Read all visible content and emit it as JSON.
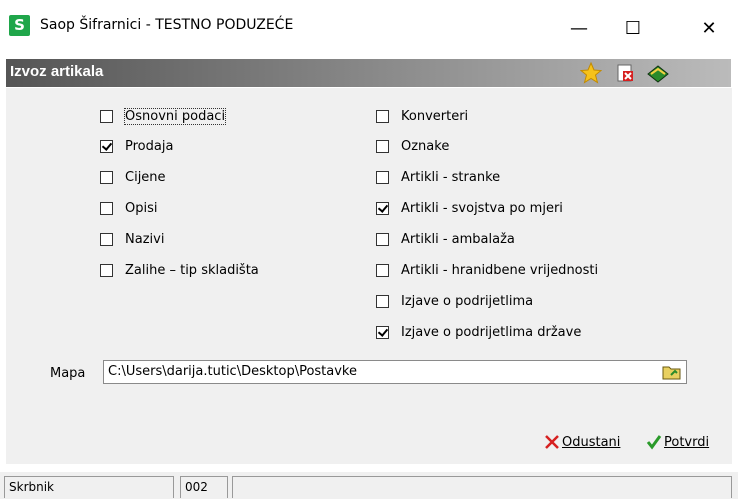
{
  "window": {
    "app_icon_letter": "S",
    "title": "Saop Šifrarnici - TESTNO PODUZEĆE",
    "minimize": "—",
    "maximize": "☐",
    "close": "✕"
  },
  "banner": {
    "title": "Izvoz artikala",
    "icons": [
      "star-icon",
      "delete-icon",
      "book-icon"
    ]
  },
  "left_checkboxes": [
    {
      "label": "Osnovni podaci",
      "checked": false
    },
    {
      "label": "Prodaja",
      "checked": true
    },
    {
      "label": "Cijene",
      "checked": false
    },
    {
      "label": "Opisi",
      "checked": false
    },
    {
      "label": "Nazivi",
      "checked": false
    },
    {
      "label": "Zalihe – tip skladišta",
      "checked": false
    }
  ],
  "right_checkboxes": [
    {
      "label": "Konverteri",
      "checked": false
    },
    {
      "label": "Oznake",
      "checked": false
    },
    {
      "label": "Artikli - stranke",
      "checked": false
    },
    {
      "label": "Artikli - svojstva po mjeri",
      "checked": true
    },
    {
      "label": "Artikli - ambalaža",
      "checked": false
    },
    {
      "label": "Artikli - hranidbene vrijednosti",
      "checked": false
    },
    {
      "label": "Izjave o podrijetlima",
      "checked": false
    },
    {
      "label": "Izjave o podrijetlima države",
      "checked": true
    }
  ],
  "mapa": {
    "label": "Mapa",
    "value": "C:\\Users\\darija.tutic\\Desktop\\Postavke"
  },
  "footer": {
    "cancel_label": "Odustani",
    "confirm_label": "Potvrdi"
  },
  "status": {
    "user": "Skrbnik",
    "code": "002"
  },
  "colors": {
    "app_icon": "#1fa64a",
    "cancel_icon": "#d62020",
    "confirm_icon": "#2a9a2a"
  }
}
